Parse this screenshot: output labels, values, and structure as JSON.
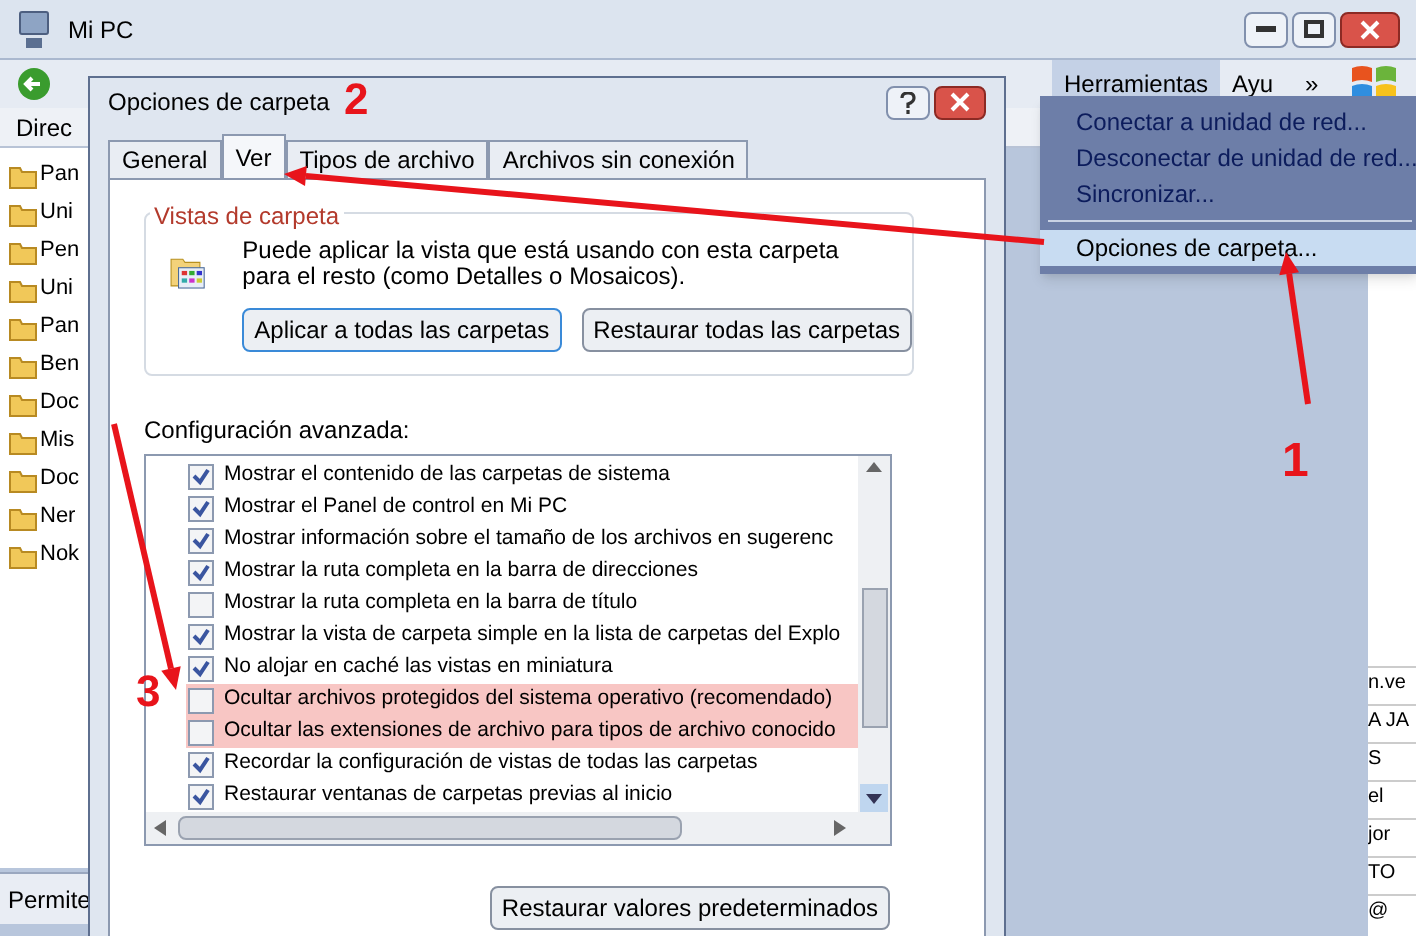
{
  "explorer": {
    "title": "Mi PC",
    "menu": [
      {
        "label": "Herramientas",
        "selected": true
      },
      {
        "label": "Ayu",
        "selected": false
      }
    ],
    "more": "»",
    "address_label": "Direc",
    "sidebar": {
      "items": [
        "Pan",
        "Uni",
        "Pen",
        "Uni",
        "Pan",
        "Ben",
        "Doc",
        "Mis",
        "Doc",
        "Ner",
        "Nok"
      ]
    },
    "status_bar": "Permite",
    "right_fragments": [
      "n.ve",
      "A JA",
      "S",
      "el",
      "jor",
      "TO",
      "@"
    ]
  },
  "tools_menu": {
    "items": [
      {
        "label": "Conectar a unidad de red...",
        "selected": false
      },
      {
        "label": "Desconectar de unidad de red...",
        "selected": false
      },
      {
        "label": "Sincronizar...",
        "selected": false
      },
      {
        "label": "Opciones de carpeta...",
        "selected": true
      }
    ]
  },
  "dialog": {
    "title": "Opciones de carpeta",
    "tabs": [
      {
        "label": "General",
        "selected": false
      },
      {
        "label": "Ver",
        "selected": true
      },
      {
        "label": "Tipos de archivo",
        "selected": false
      },
      {
        "label": "Archivos sin conexión",
        "selected": false
      }
    ],
    "folder_views": {
      "title": "Vistas de carpeta",
      "text": "Puede aplicar la vista que está usando con esta carpeta para el resto (como Detalles o Mosaicos).",
      "buttons": [
        "Aplicar a todas las carpetas",
        "Restaurar todas las carpetas"
      ]
    },
    "advanced": {
      "title": "Configuración avanzada:",
      "rows": [
        {
          "label": "Mostrar el contenido de las carpetas de sistema",
          "checked": true,
          "highlighted": false
        },
        {
          "label": "Mostrar el Panel de control en Mi PC",
          "checked": true,
          "highlighted": false
        },
        {
          "label": "Mostrar información sobre el tamaño de los archivos en sugerenc",
          "checked": true,
          "highlighted": false
        },
        {
          "label": "Mostrar la ruta completa en la barra de direcciones",
          "checked": true,
          "highlighted": false
        },
        {
          "label": "Mostrar la ruta completa en la barra de título",
          "checked": false,
          "highlighted": false
        },
        {
          "label": "Mostrar la vista de carpeta simple en la lista de carpetas del Explo",
          "checked": true,
          "highlighted": false
        },
        {
          "label": "No alojar en caché las vistas en miniatura",
          "checked": true,
          "highlighted": false
        },
        {
          "label": "Ocultar archivos protegidos del sistema operativo (recomendado)",
          "checked": false,
          "highlighted": true
        },
        {
          "label": "Ocultar las extensiones de archivo para tipos de archivo conocido",
          "checked": false,
          "highlighted": true
        },
        {
          "label": "Recordar la configuración de vistas de todas las carpetas",
          "checked": true,
          "highlighted": false
        },
        {
          "label": "Restaurar ventanas de carpetas previas al inicio",
          "checked": true,
          "highlighted": false
        }
      ]
    },
    "restore_defaults": "Restaurar valores predeterminados"
  },
  "annotations": [
    {
      "label": "1"
    },
    {
      "label": "2"
    },
    {
      "label": "3"
    }
  ]
}
